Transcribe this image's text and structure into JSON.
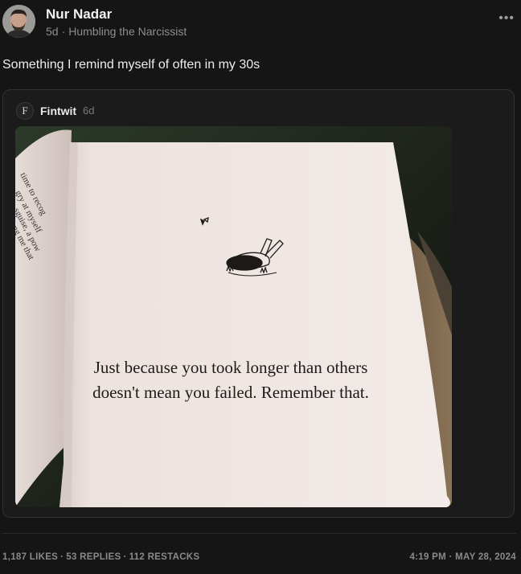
{
  "post": {
    "author_name": "Nur Nadar",
    "time_ago": "5d",
    "separator": "·",
    "publication": "Humbling the Narcissist",
    "more_icon": "•••",
    "text": "Something I remind myself of often in my 30s"
  },
  "quoted": {
    "avatar_letter": "F",
    "author": "Fintwit",
    "time_ago": "6d",
    "image_text": "Just because you took longer than others doesn't mean you failed. Remember that.",
    "left_page_fragments": [
      "time to recog",
      "gry at myself",
      "sguise, a pow",
      "ng me that"
    ]
  },
  "footer": {
    "likes": "1,187 LIKES",
    "replies": "53 REPLIES",
    "restacks": "112 RESTACKS",
    "stat_sep": "·",
    "timestamp": "4:19 PM · MAY 28, 2024"
  },
  "colors": {
    "background": "#151515",
    "card": "#1b1b1b",
    "page": "#efe5e1"
  }
}
